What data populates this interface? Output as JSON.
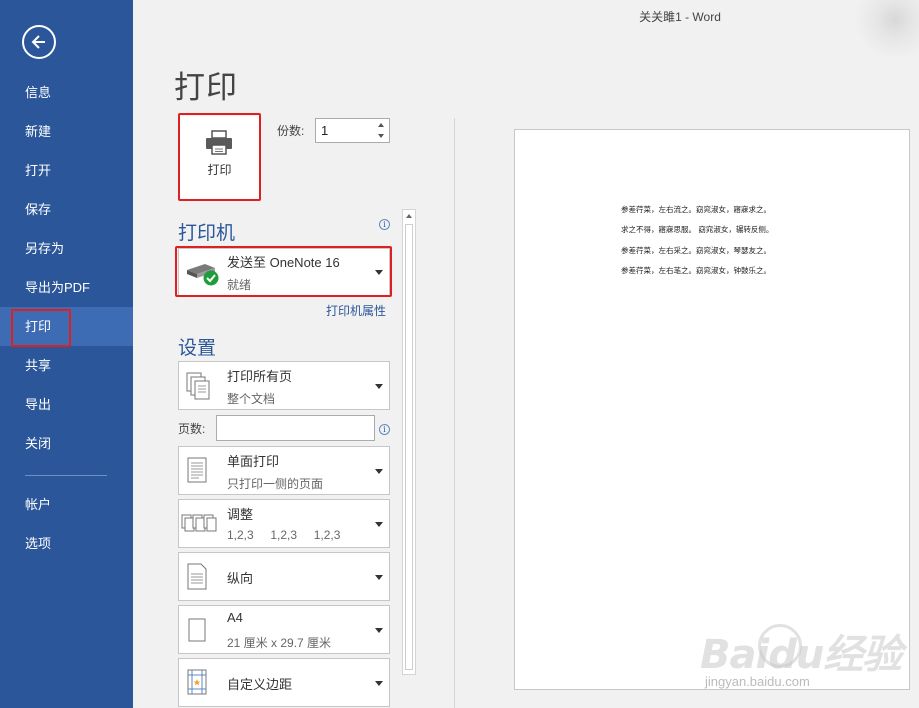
{
  "window": {
    "title": "关关雎1 - Word"
  },
  "nav": {
    "items": [
      {
        "label": "信息"
      },
      {
        "label": "新建"
      },
      {
        "label": "打开"
      },
      {
        "label": "保存"
      },
      {
        "label": "另存为"
      },
      {
        "label": "导出为PDF"
      },
      {
        "label": "打印"
      },
      {
        "label": "共享"
      },
      {
        "label": "导出"
      },
      {
        "label": "关闭"
      },
      {
        "label": "帐户"
      },
      {
        "label": "选项"
      }
    ],
    "active": "打印"
  },
  "print": {
    "heading": "打印",
    "print_button_label": "打印",
    "copies_label": "份数:",
    "copies_value": "1"
  },
  "printer": {
    "section_title": "打印机",
    "name": "发送至 OneNote 16",
    "status": "就绪",
    "properties_link": "打印机属性"
  },
  "settings": {
    "section_title": "设置",
    "pages_label": "页数:",
    "pages_value": "",
    "options": [
      {
        "title": "打印所有页",
        "subtitle": "整个文档",
        "icon": "pages-icon"
      },
      {
        "title": "单面打印",
        "subtitle": "只打印一侧的页面",
        "icon": "single-side-icon"
      },
      {
        "title": "调整",
        "subtitle": "1,2,3     1,2,3     1,2,3",
        "icon": "collate-icon"
      },
      {
        "title": "纵向",
        "subtitle": "",
        "icon": "portrait-icon"
      },
      {
        "title": "A4",
        "subtitle": "21 厘米 x 29.7 厘米",
        "icon": "paper-size-icon"
      },
      {
        "title": "自定义边距",
        "subtitle": "",
        "icon": "margins-icon"
      }
    ]
  },
  "preview": {
    "lines": [
      "参差荇菜，左右流之。窈窕淑女，寤寐求之。",
      "求之不得，寤寐思服。 窈窕淑女，辗转反侧。",
      "参差荇菜，左右采之。窈窕淑女，琴瑟友之。",
      "参差荇菜，左右芼之。窈窕淑女，钟鼓乐之。"
    ]
  },
  "watermark": {
    "text": "Baidu经验",
    "url": "jingyan.baidu.com"
  },
  "colors": {
    "nav_bg": "#2b579a",
    "nav_active": "#3d6cb5",
    "accent": "#2b579a",
    "highlight_box": "#e02020"
  }
}
